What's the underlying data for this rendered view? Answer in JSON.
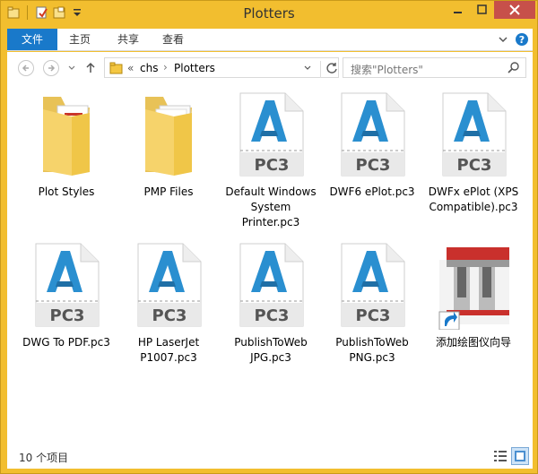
{
  "window": {
    "title": "Plotters"
  },
  "ribbon": {
    "tabs": [
      {
        "label": "文件"
      },
      {
        "label": "主页"
      },
      {
        "label": "共享"
      },
      {
        "label": "查看"
      }
    ]
  },
  "address": {
    "overflow": "«",
    "crumbs": [
      "chs",
      "Plotters"
    ]
  },
  "search": {
    "placeholder": "搜索\"Plotters\""
  },
  "items": [
    {
      "label": "Plot Styles",
      "icon": "folder-icon"
    },
    {
      "label": "PMP Files",
      "icon": "folder-icon"
    },
    {
      "label": "Default Windows System Printer.pc3",
      "icon": "pc3-file-icon"
    },
    {
      "label": "DWF6 ePlot.pc3",
      "icon": "pc3-file-icon"
    },
    {
      "label": "DWFx ePlot (XPS Compatible).pc3",
      "icon": "pc3-file-icon"
    },
    {
      "label": "DWG To PDF.pc3",
      "icon": "pc3-file-icon"
    },
    {
      "label": "HP LaserJet P1007.pc3",
      "icon": "pc3-file-icon"
    },
    {
      "label": "PublishToWeb JPG.pc3",
      "icon": "pc3-file-icon"
    },
    {
      "label": "PublishToWeb PNG.pc3",
      "icon": "pc3-file-icon"
    },
    {
      "label": "添加绘图仪向导",
      "icon": "plotter-wizard-shortcut-icon"
    }
  ],
  "pc3_badge": "PC3",
  "status": {
    "count": "10 个项目"
  },
  "colors": {
    "titlebar": "#f2be2f",
    "file_tab": "#1979ca",
    "close_button": "#c7504a",
    "autocad_blue": "#2a8fd0"
  }
}
